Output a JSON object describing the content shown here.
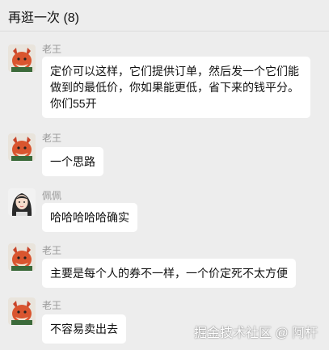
{
  "header": {
    "title": "再逛一次 (8)"
  },
  "messages": [
    {
      "sender": "老王",
      "avatar": "fox-avatar",
      "text": "定价可以这样，它们提供订单，然后发一个它们能做到的最低价，你如果能更低，省下来的钱平分。你们55开"
    },
    {
      "sender": "老王",
      "avatar": "fox-avatar",
      "text": "一个思路"
    },
    {
      "sender": "佩佩",
      "avatar": "girl-avatar",
      "text": "哈哈哈哈哈确实"
    },
    {
      "sender": "老王",
      "avatar": "fox-avatar",
      "text": "主要是每个人的券不一样，一个价定死不太方便"
    },
    {
      "sender": "老王",
      "avatar": "fox-avatar",
      "text": "不容易卖出去"
    }
  ],
  "watermark": "掘金技术社区 @ 阿杆"
}
